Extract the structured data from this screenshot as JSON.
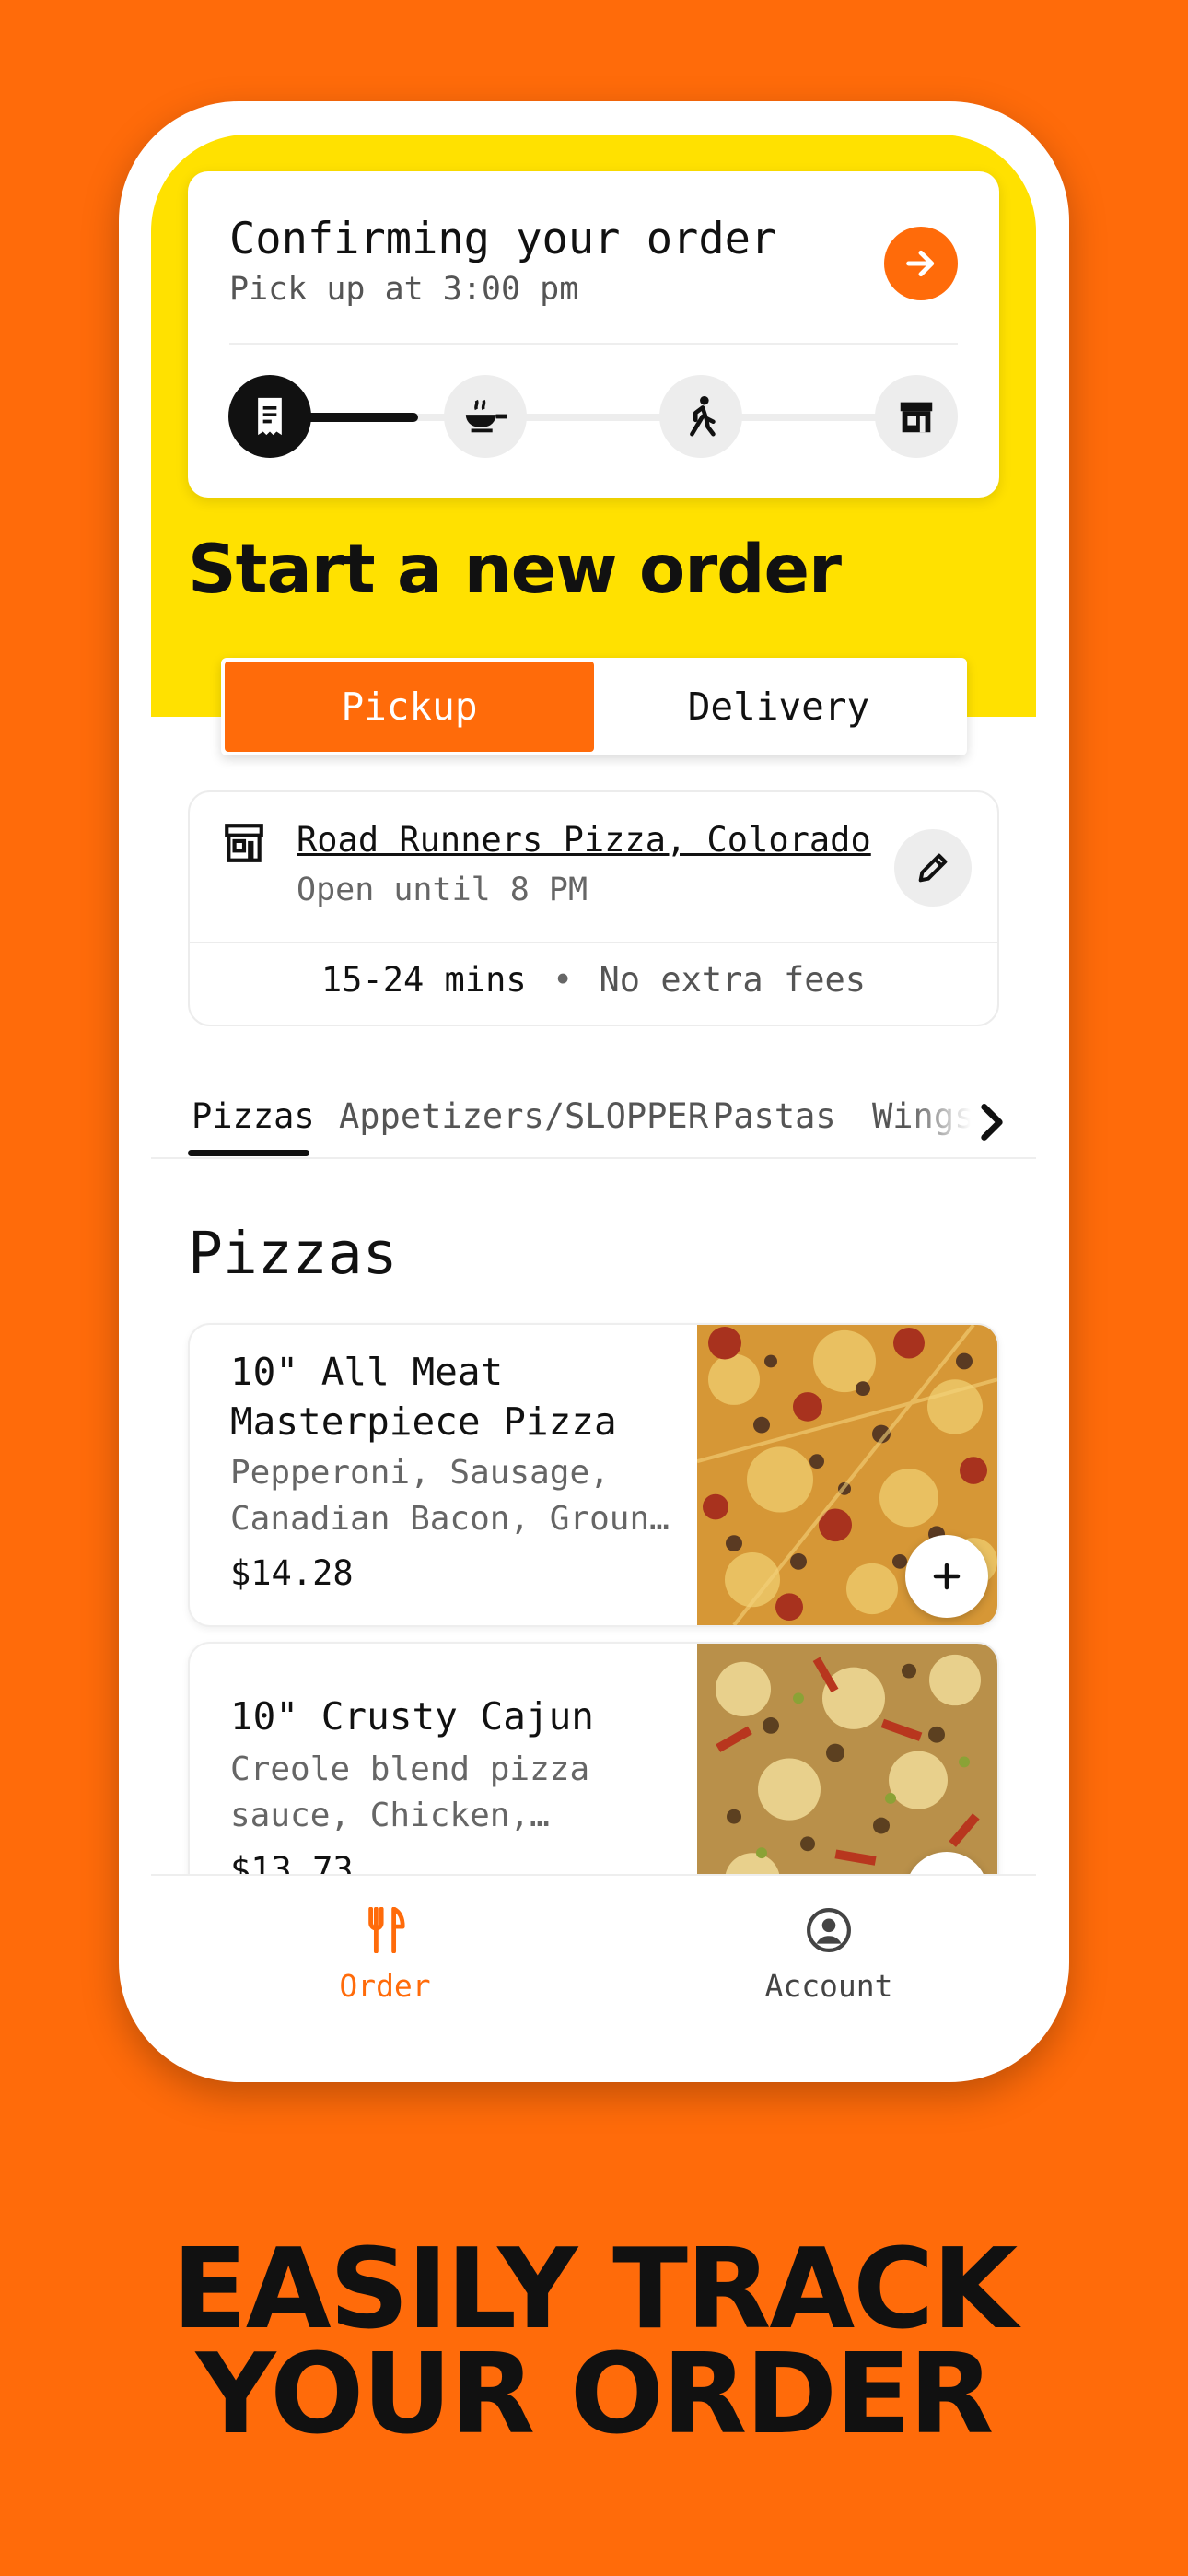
{
  "order_status": {
    "title": "Confirming your order",
    "subtitle": "Pick up at 3:00 pm",
    "steps": [
      {
        "icon": "receipt-icon",
        "active": true
      },
      {
        "icon": "cooking-pan-icon",
        "active": false
      },
      {
        "icon": "walking-person-icon",
        "active": false
      },
      {
        "icon": "storefront-icon",
        "active": false
      }
    ]
  },
  "start_order": {
    "heading": "Start a new order",
    "modes": [
      "Pickup",
      "Delivery"
    ],
    "selected_mode": "Pickup"
  },
  "store": {
    "name": "Road Runners Pizza, Colorado",
    "hours": "Open until 8 PM",
    "eta": "15-24 mins",
    "separator": "•",
    "fees": "No extra fees"
  },
  "category_tabs": [
    "Pizzas",
    "Appetizers/SLOPPER",
    "Pastas",
    "Wings"
  ],
  "menu_section": {
    "heading": "Pizzas",
    "items": [
      {
        "name": "10\" All Meat Masterpiece Pizza",
        "description": "Pepperoni, Sausage, Canadian Bacon, Groun…",
        "price": "$14.28"
      },
      {
        "name": "10\" Crusty Cajun",
        "description": "Creole blend pizza sauce, Chicken,…",
        "price": "$13.73"
      }
    ]
  },
  "bottom_nav": {
    "order": "Order",
    "account": "Account"
  },
  "headline": {
    "line1": "EASILY TRACK",
    "line2": "YOUR ORDER"
  },
  "colors": {
    "brand_orange": "#FF6B0A",
    "brand_yellow": "#FFE100",
    "text": "#111111"
  }
}
